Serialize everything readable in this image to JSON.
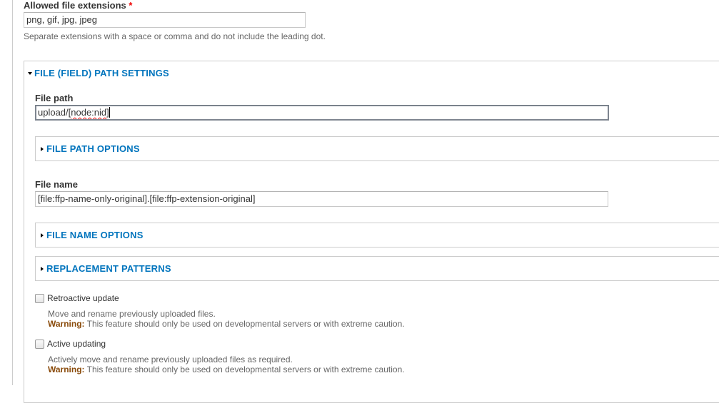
{
  "allowed_extensions": {
    "label": "Allowed file extensions",
    "required_marker": "*",
    "value": "png, gif, jpg, jpeg",
    "description": "Separate extensions with a space or comma and do not include the leading dot."
  },
  "path_settings": {
    "legend": "FILE (FIELD) PATH SETTINGS",
    "expanded": true,
    "file_path": {
      "label": "File path",
      "value_prefix": "upload/[",
      "value_misspelled": "node:nid",
      "value_suffix": "]"
    },
    "file_path_options": {
      "legend": "FILE PATH OPTIONS",
      "expanded": false
    },
    "file_name": {
      "label": "File name",
      "value": "[file:ffp-name-only-original].[file:ffp-extension-original]"
    },
    "file_name_options": {
      "legend": "FILE NAME OPTIONS",
      "expanded": false
    },
    "replacement_patterns": {
      "legend": "REPLACEMENT PATTERNS",
      "expanded": false
    },
    "retroactive_update": {
      "label": "Retroactive update",
      "checked": false,
      "description": "Move and rename previously uploaded files.",
      "warning_label": "Warning:",
      "warning_text": " This feature should only be used on developmental servers or with extreme caution."
    },
    "active_updating": {
      "label": "Active updating",
      "checked": false,
      "description": "Actively move and rename previously uploaded files as required.",
      "warning_label": "Warning:",
      "warning_text": " This feature should only be used on developmental servers or with extreme caution."
    }
  },
  "colors": {
    "link_blue": "#0074bd",
    "required_red": "#ee0000",
    "warning_brown": "#8a4b0b",
    "border_gray": "#cccccc"
  }
}
